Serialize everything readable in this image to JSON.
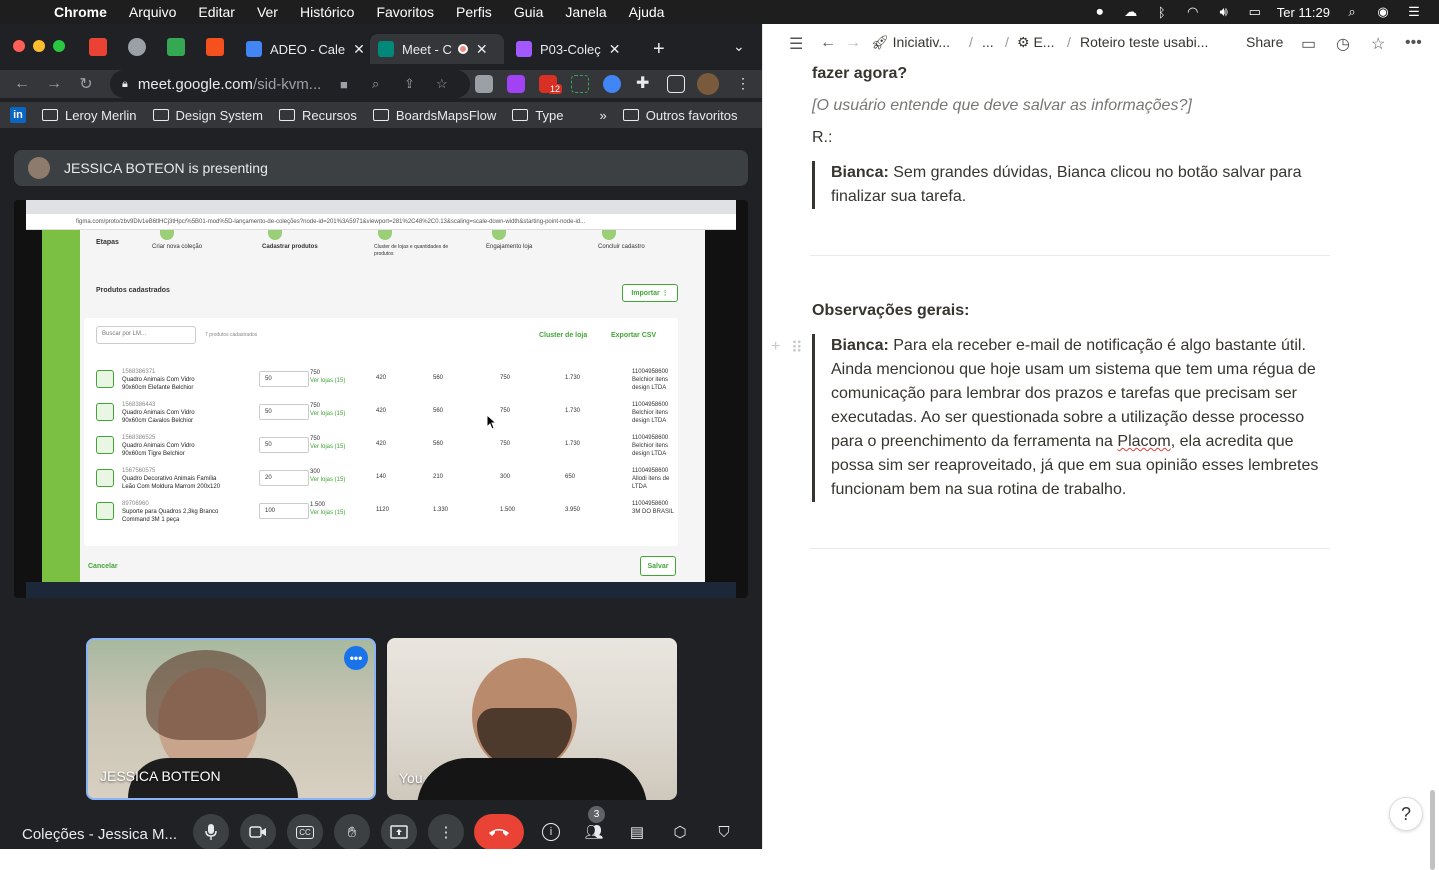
{
  "menubar": {
    "app": "Chrome",
    "items": [
      "Arquivo",
      "Editar",
      "Ver",
      "Histórico",
      "Favoritos",
      "Perfis",
      "Guia",
      "Janela",
      "Ajuda"
    ],
    "clock": "Ter 11:29"
  },
  "chrome": {
    "tabs": [
      {
        "label": "ADEO - Cale",
        "color": "#4285f4"
      },
      {
        "label": "Meet - C",
        "color": "#00897b"
      },
      {
        "label": "P03-Coleç",
        "color": "#a259ff"
      }
    ],
    "url": {
      "host": "meet.google.com",
      "path": "/sid-kvm..."
    },
    "bookmarks": [
      "Leroy Merlin",
      "Design System",
      "Recursos",
      "BoardsMapsFlow",
      "Type"
    ],
    "bookmarks_more": "»",
    "other_favorites": "Outros favoritos",
    "ext_badge": "12"
  },
  "meet": {
    "presenting": "JESSICA BOTEON is presenting",
    "tile1_label": "JESSICA BOTEON",
    "tile2_label": "You",
    "meeting_title": "Coleções - Jessica M...",
    "participants_count": "3",
    "shared": {
      "addr": "figma.com/proto/zbv9Dlv1eB6tlHCj3tHpc/%5B01-mod%5D-lançamento-de-coleções?node-id=201%3A5971&viewport=281%2C48%2C0.13&scaling=scale-down-width&starting-point-node-id...",
      "steps_label": "Etapas",
      "steps": [
        "Criar nova coleção",
        "Cadastrar produtos",
        "Cluster de lojas e quantidades de produtos",
        "Engajamento loja",
        "Concluir cadastro"
      ],
      "section_title": "Produtos cadastrados",
      "import_btn": "Importar ⋮",
      "search_placeholder": "Buscar por LM...",
      "count_text": "7 produtos cadastrados",
      "cluster_link": "Cluster de loja",
      "export_link": "Exportar CSV",
      "view_stores": "Ver lojas (15)",
      "rows": [
        {
          "code": "1568386371",
          "name1": "Quadro Animais Com Vidro",
          "name2": "90x60cm Elefante Belchior",
          "qty": "50",
          "v1": "750",
          "v2": "420",
          "v3": "560",
          "v4": "750",
          "v5": "1.730",
          "sup_code": "11004958600",
          "sup1": "Belchior itens",
          "sup2": "design LTDA"
        },
        {
          "code": "1568386443",
          "name1": "Quadro Animais Com Vidro",
          "name2": "90x60cm Cavalos Belchior",
          "qty": "50",
          "v1": "750",
          "v2": "420",
          "v3": "560",
          "v4": "750",
          "v5": "1.730",
          "sup_code": "11004958600",
          "sup1": "Belchior itens",
          "sup2": "design LTDA"
        },
        {
          "code": "1568386525",
          "name1": "Quadro Animais Com Vidro",
          "name2": "90x60cm Tigre Belchior",
          "qty": "50",
          "v1": "750",
          "v2": "420",
          "v3": "560",
          "v4": "750",
          "v5": "1.730",
          "sup_code": "11004958600",
          "sup1": "Belchior itens",
          "sup2": "design LTDA"
        },
        {
          "code": "1567560575",
          "name1": "Quadro Decorativo Animais Família",
          "name2": "Leão Com Moldura Marrom 200x120",
          "qty": "20",
          "v1": "300",
          "v2": "140",
          "v3": "210",
          "v4": "300",
          "v5": "650",
          "sup_code": "11004958600",
          "sup1": "Allodi itens de",
          "sup2": "LTDA"
        },
        {
          "code": "89706960",
          "name1": "Suporte para Quadros 2,3kg Branco",
          "name2": "Command 3M 1 peça",
          "qty": "100",
          "v1": "1.500",
          "v2": "1120",
          "v3": "1.330",
          "v4": "1.500",
          "v5": "3.950",
          "sup_code": "11004958600",
          "sup1": "3M DO BRASIL",
          "sup2": ""
        }
      ],
      "cancel": "Cancelar",
      "save": "Salvar"
    }
  },
  "notion": {
    "breadcrumbs": [
      "Iniciativ...",
      "...",
      "E...",
      "Roteiro teste usabi..."
    ],
    "share": "Share",
    "q_tail": "fazer agora?",
    "q_hint": "[O usuário entende que deve salvar as informações?]",
    "answer_label": "R.:",
    "quote1_name": "Bianca:",
    "quote1_text": " Sem grandes dúvidas, Bianca clicou no botão salvar para finalizar sua tarefa.",
    "obs_title": "Observações gerais:",
    "quote2_name": "Bianca:",
    "quote2_pre": "  Para ela receber e-mail de notificação é algo bastante útil. Ainda mencionou que hoje usam um sistema que tem uma régua de comunicação para lembrar dos prazos e tarefas que precisam ser executadas. Ao ser questionada sobre a utilização desse processo para o preenchimento da ferramenta na ",
    "quote2_link": "Placom",
    "quote2_post": ", ela acredita que possa sim ser reaproveitado, já que em sua opinião esses lembretes funcionam bem na sua rotina de trabalho.",
    "help": "?"
  }
}
